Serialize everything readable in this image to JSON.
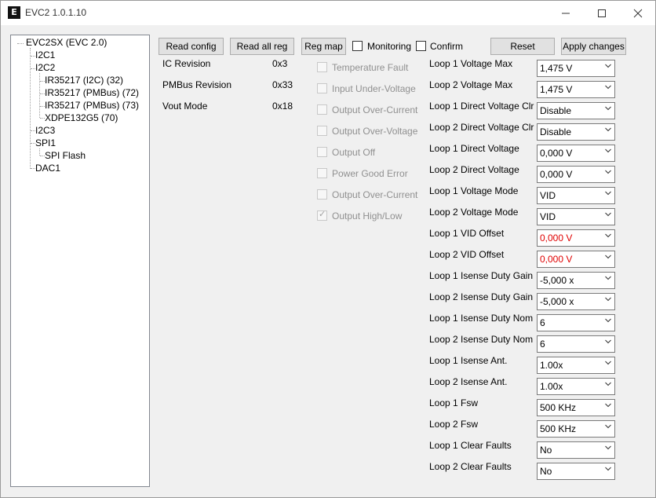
{
  "window": {
    "title": "EVC2 1.0.1.10",
    "icon_letter": "E"
  },
  "tree": {
    "root": "EVC2SX (EVC 2.0)",
    "nodes": [
      "I2C1",
      "I2C2",
      "IR35217 (I2C) (32)",
      "IR35217 (PMBus) (72)",
      "IR35217 (PMBus) (73)",
      "XDPE132G5 (70)",
      "I2C3",
      "SPI1",
      "SPI Flash",
      "DAC1"
    ]
  },
  "toolbar": {
    "read_config": "Read config",
    "read_all_reg": "Read all reg",
    "reg_map": "Reg map",
    "monitoring": "Monitoring",
    "confirm": "Confirm",
    "reset": "Reset",
    "apply_changes": "Apply changes"
  },
  "info": [
    {
      "label": "IC Revision",
      "value": "0x3"
    },
    {
      "label": "PMBus Revision",
      "value": "0x33"
    },
    {
      "label": "Vout Mode",
      "value": "0x18"
    }
  ],
  "flags": [
    {
      "label": "Temperature Fault",
      "checked": false
    },
    {
      "label": "Input Under-Voltage",
      "checked": false
    },
    {
      "label": "Output Over-Current",
      "checked": false
    },
    {
      "label": "Output Over-Voltage",
      "checked": false
    },
    {
      "label": "Output Off",
      "checked": false
    },
    {
      "label": "Power Good Error",
      "checked": false
    },
    {
      "label": "Output Over-Current",
      "checked": false
    },
    {
      "label": "Output High/Low",
      "checked": true
    }
  ],
  "params": [
    {
      "label": "Loop 1 Voltage Max",
      "value": "1,475 V"
    },
    {
      "label": "Loop 2 Voltage Max",
      "value": "1,475 V"
    },
    {
      "label": "Loop 1 Direct Voltage Clr",
      "value": "Disable"
    },
    {
      "label": "Loop 2 Direct Voltage Clr",
      "value": "Disable"
    },
    {
      "label": "Loop 1 Direct Voltage",
      "value": "0,000 V"
    },
    {
      "label": "Loop 2 Direct Voltage",
      "value": "0,000 V"
    },
    {
      "label": "Loop 1 Voltage Mode",
      "value": "VID"
    },
    {
      "label": "Loop 2 Voltage Mode",
      "value": "VID"
    },
    {
      "label": "Loop 1 VID Offset",
      "value": "0,000 V",
      "highlight": "#e00000"
    },
    {
      "label": "Loop 2 VID Offset",
      "value": "0,000 V",
      "highlight": "#e00000"
    },
    {
      "label": "Loop 1 Isense Duty Gain",
      "value": "-5,000 x"
    },
    {
      "label": "Loop 2 Isense Duty Gain",
      "value": "-5,000 x"
    },
    {
      "label": "Loop 1 Isense Duty Nom",
      "value": "6"
    },
    {
      "label": "Loop 2 Isense Duty Nom",
      "value": "6"
    },
    {
      "label": "Loop 1 Isense Ant.",
      "value": "1.00x"
    },
    {
      "label": "Loop 2 Isense Ant.",
      "value": "1.00x"
    },
    {
      "label": "Loop 1 Fsw",
      "value": "500 KHz"
    },
    {
      "label": "Loop 2 Fsw",
      "value": "500 KHz"
    },
    {
      "label": "Loop 1 Clear Faults",
      "value": "No"
    },
    {
      "label": "Loop 2 Clear Faults",
      "value": "No"
    }
  ]
}
